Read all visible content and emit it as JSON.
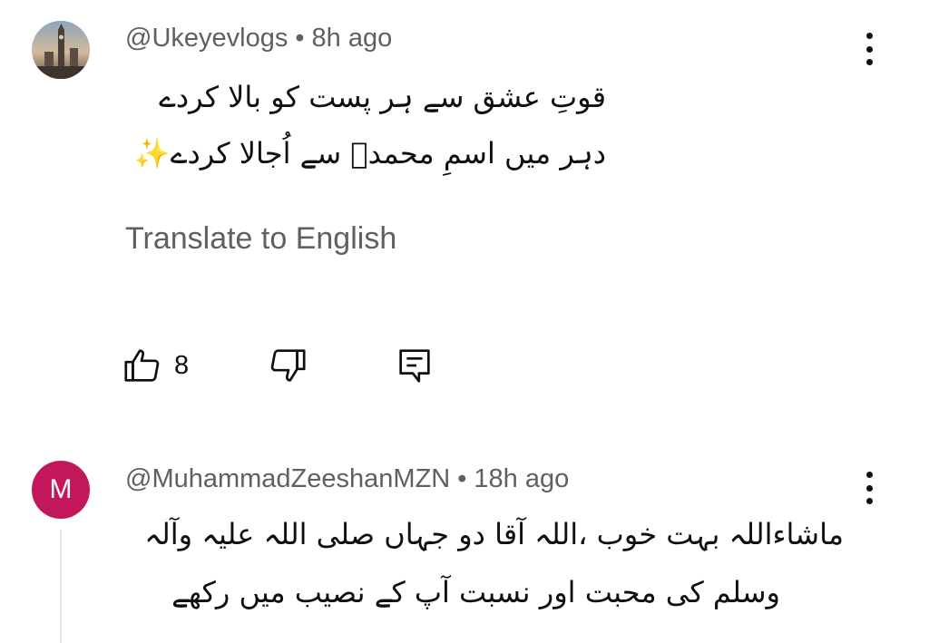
{
  "comments": [
    {
      "author": "@Ukeyevlogs",
      "separator": "•",
      "time": "8h ago",
      "avatar_type": "photo",
      "lines": [
        "قوتِ عشق سے ہر پست کو بالا کردے",
        "دہر میں اسمِ محمدؐ سے اُجالا کردے✨"
      ],
      "translate_label": "Translate to English",
      "like_count": "8",
      "icons": {
        "more": "kebab-menu-icon",
        "like": "thumbs-up-icon",
        "dislike": "thumbs-down-icon",
        "reply": "reply-icon"
      }
    },
    {
      "author": "@MuhammadZeeshanMZN",
      "separator": "•",
      "time": "18h ago",
      "avatar_type": "letter",
      "avatar_letter": "M",
      "avatar_color": "#c2185b",
      "lines": [
        "ماشاءاللہ بہت خوب ،اللہ  آقا دو جہاں صلی اللہ علیہ وآلہ",
        "وسلم کی محبت اور نسبت  آپ کے نصیب میں رکھے"
      ],
      "icons": {
        "more": "kebab-menu-icon"
      }
    }
  ]
}
